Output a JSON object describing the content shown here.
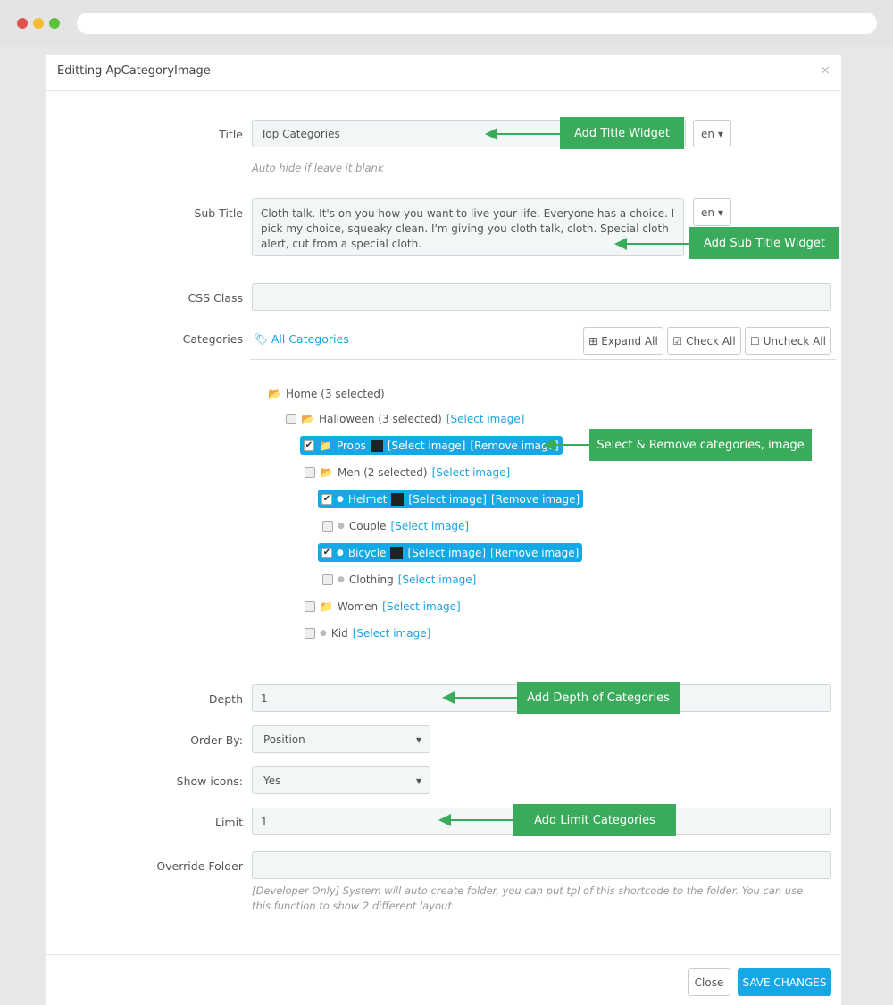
{
  "modal": {
    "title": "Editting ApCategoryImage",
    "close_icon": "×"
  },
  "form": {
    "title_label": "Title",
    "title_value": "Top Categories",
    "lang": "en",
    "title_help": "Auto hide if leave it blank",
    "subtitle_label": "Sub Title",
    "subtitle_value": "Cloth talk. It's on you how you want to live your life. Everyone has a choice. I pick my choice, squeaky clean. I'm giving you cloth talk, cloth. Special cloth alert, cut from a special cloth.",
    "css_label": "CSS Class",
    "css_value": "",
    "categories_label": "Categories",
    "all_categories": "All Categories",
    "expand_all": "Expand All",
    "check_all": "Check All",
    "uncheck_all": "Uncheck All",
    "depth_label": "Depth",
    "depth_value": "1",
    "order_label": "Order By:",
    "order_value": "Position",
    "icons_label": "Show icons:",
    "icons_value": "Yes",
    "limit_label": "Limit",
    "limit_value": "1",
    "override_label": "Override Folder",
    "override_value": "",
    "override_help": "[Developer Only] System will auto create folder, you can put tpl of this shortcode to the folder. You can use this function to show 2 different layout"
  },
  "tree": {
    "home": "Home (3 selected)",
    "select_image": "[Select image]",
    "remove_image": "[Remove image]",
    "items": [
      {
        "label": "Halloween (3 selected)",
        "checked": false
      },
      {
        "label": "Props",
        "checked": true
      },
      {
        "label": "Men (2 selected)",
        "checked": false
      },
      {
        "label": "Helmet",
        "checked": true
      },
      {
        "label": "Couple",
        "checked": false
      },
      {
        "label": "Bicycle",
        "checked": true
      },
      {
        "label": "Clothing",
        "checked": false
      },
      {
        "label": "Women",
        "checked": false
      },
      {
        "label": "Kid",
        "checked": false
      }
    ]
  },
  "callouts": {
    "title": "Add Title Widget",
    "subtitle": "Add Sub Title Widget",
    "categories": "Select & Remove categories, image",
    "depth": "Add Depth of Categories",
    "limit": "Add Limit Categories"
  },
  "footer": {
    "close": "Close",
    "save": "SAVE CHANGES"
  },
  "colors": {
    "accent": "#14a8e6",
    "callout": "#3aab5a"
  }
}
